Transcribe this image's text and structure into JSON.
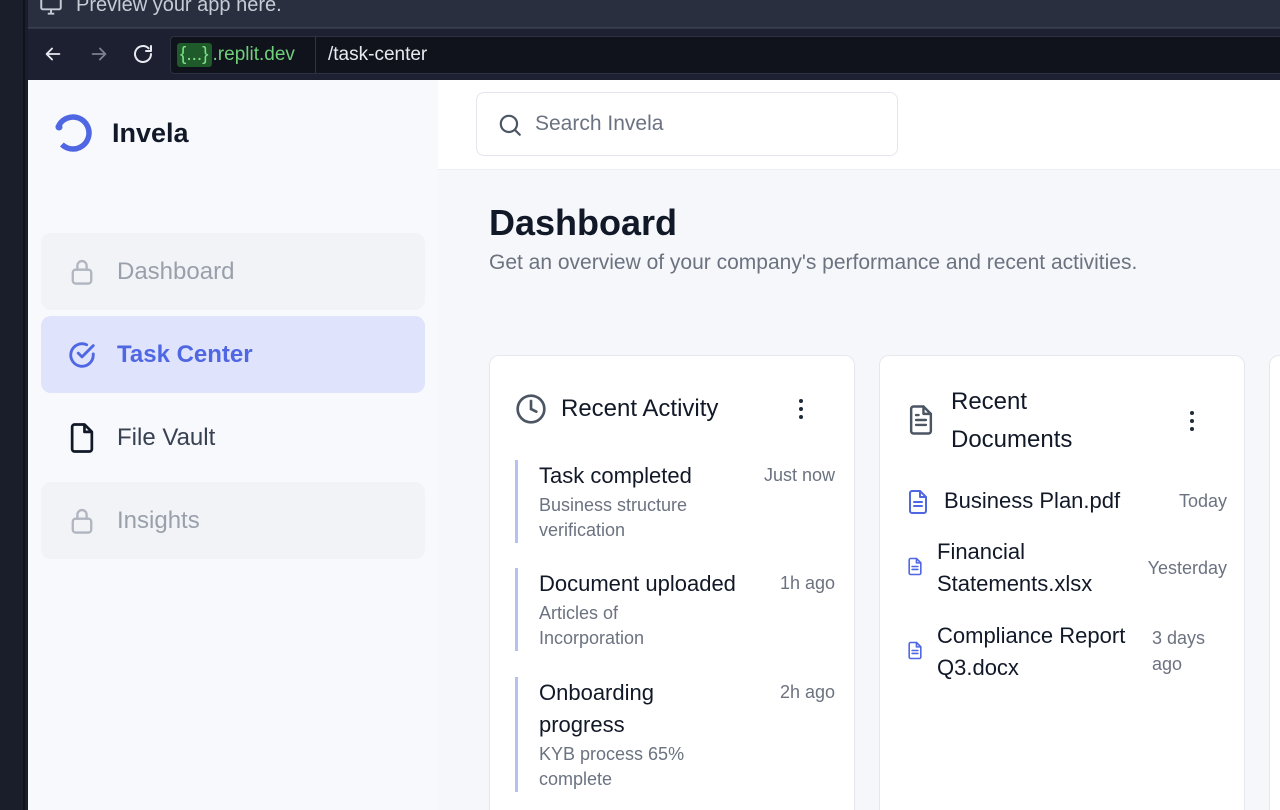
{
  "preview": {
    "text": "Preview your app here."
  },
  "browser": {
    "url_braces": "{...}",
    "url_host": ".replit.dev",
    "url_path": "/task-center"
  },
  "app": {
    "name": "Invela",
    "accent": "#4f67e3"
  },
  "search": {
    "placeholder": "Search Invela"
  },
  "sidebar": {
    "items": [
      {
        "label": "Dashboard",
        "icon": "lock-icon",
        "state": "locked"
      },
      {
        "label": "Task Center",
        "icon": "check-circle-icon",
        "state": "active"
      },
      {
        "label": "File Vault",
        "icon": "file-icon",
        "state": "normal"
      },
      {
        "label": "Insights",
        "icon": "lock-icon",
        "state": "locked"
      }
    ]
  },
  "page": {
    "title": "Dashboard",
    "subtitle": "Get an overview of your company's performance and recent activities."
  },
  "recent_activity": {
    "title": "Recent Activity",
    "items": [
      {
        "title": "Task completed",
        "desc": "Business structure verification",
        "time": "Just now"
      },
      {
        "title": "Document uploaded",
        "desc": "Articles of Incorporation",
        "time": "1h ago"
      },
      {
        "title": "Onboarding progress",
        "desc": "KYB process 65% complete",
        "time": "2h ago"
      }
    ]
  },
  "recent_documents": {
    "title": "Recent Documents",
    "items": [
      {
        "name": "Business Plan.pdf",
        "time": "Today"
      },
      {
        "name": "Financial Statements.xlsx",
        "time": "Yesterday"
      },
      {
        "name": "Compliance Report Q3.docx",
        "time": "3 days ago"
      }
    ]
  }
}
